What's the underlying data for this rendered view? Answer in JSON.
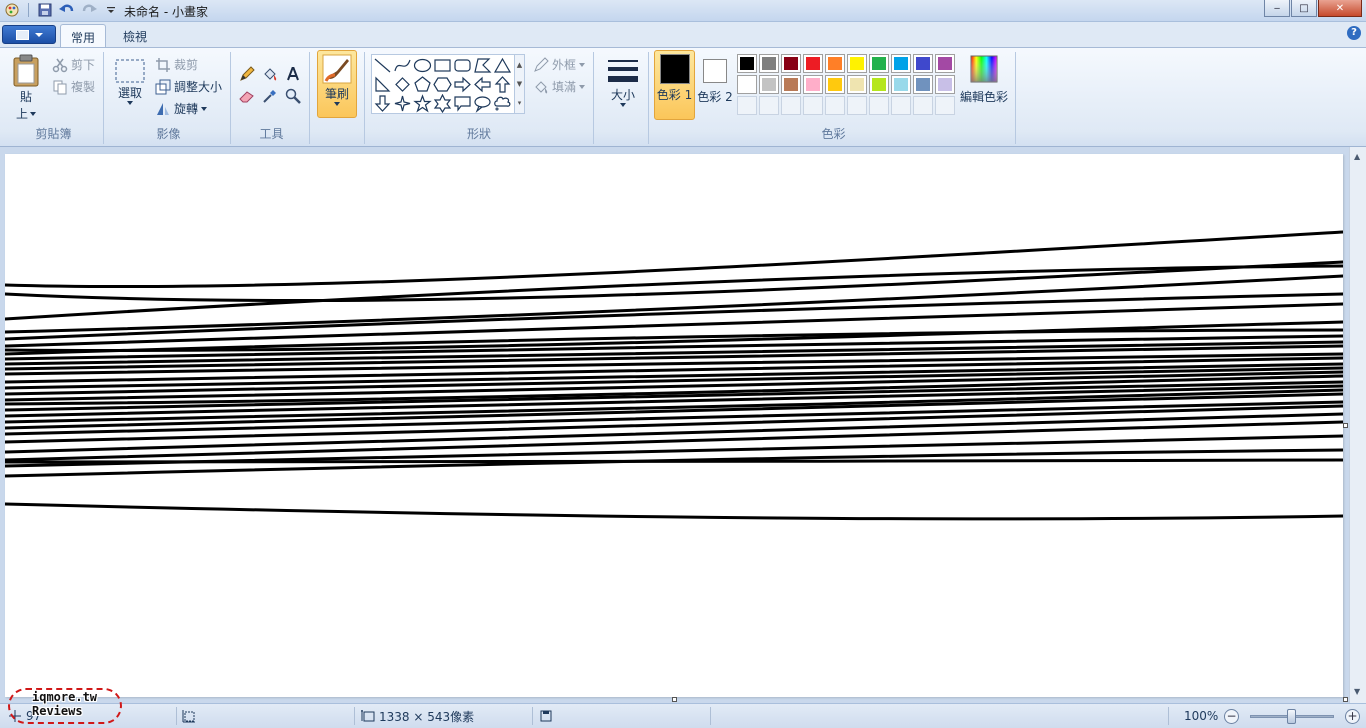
{
  "window": {
    "title": "未命名 - 小畫家",
    "minimize_glyph": "‒",
    "maximize_glyph": "□",
    "close_glyph": "✕"
  },
  "tabs": [
    {
      "label": "常用",
      "active": true
    },
    {
      "label": "檢視",
      "active": false
    }
  ],
  "help_glyph": "?",
  "ribbon": {
    "clipboard": {
      "paste_label_1": "貼",
      "paste_label_2": "上",
      "cut": "剪下",
      "copy": "複製",
      "group_label": "剪貼簿"
    },
    "image": {
      "select": "選取",
      "crop": "裁剪",
      "resize": "調整大小",
      "rotate": "旋轉",
      "group_label": "影像"
    },
    "tools": {
      "group_label": "工具"
    },
    "brush": {
      "label": "筆刷"
    },
    "shapes": {
      "outline": "外框",
      "fill": "填滿",
      "group_label": "形狀"
    },
    "size": {
      "label": "大小"
    },
    "colors": {
      "color1": "色彩 1",
      "color2": "色彩 2",
      "edit_colors": "編輯色彩",
      "group_label": "色彩",
      "color1_value": "#000000",
      "color2_value": "#ffffff",
      "palette_row1": [
        "#000000",
        "#7f7f7f",
        "#880015",
        "#ed1c24",
        "#ff7f27",
        "#fff200",
        "#22b14c",
        "#00a2e8",
        "#3f48cc",
        "#a349a4"
      ],
      "palette_row2": [
        "#ffffff",
        "#c3c3c3",
        "#b97a57",
        "#ffaec9",
        "#ffc90e",
        "#efe4b0",
        "#b5e61d",
        "#99d9ea",
        "#7092be",
        "#c8bfe7"
      ]
    }
  },
  "status": {
    "cursor_pos": "97",
    "canvas_size": "1338 × 543像素",
    "zoom": "100%",
    "zoom_minus": "−",
    "zoom_plus": "+"
  },
  "watermark": {
    "line1": "iqmore.tw",
    "line2": "Reviews"
  }
}
